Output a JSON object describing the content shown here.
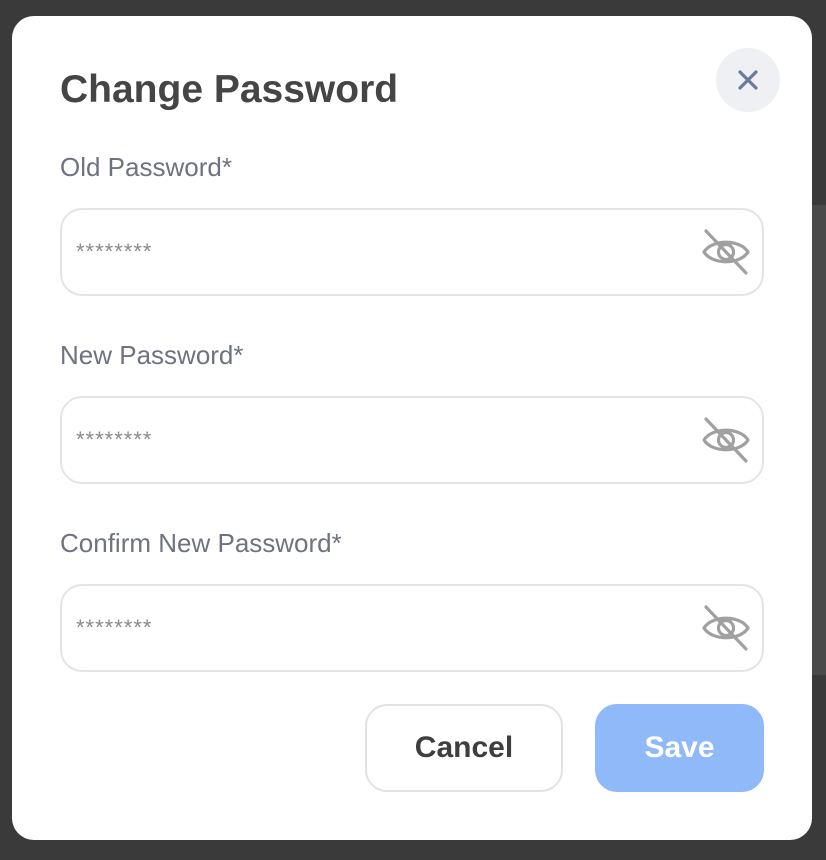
{
  "dialog": {
    "title": "Change Password",
    "close_icon": "close-icon"
  },
  "fields": [
    {
      "label": "Old Password*",
      "placeholder": "********",
      "value": "",
      "icon": "eye-off-icon"
    },
    {
      "label": "New Password*",
      "placeholder": "********",
      "value": "",
      "icon": "eye-off-icon"
    },
    {
      "label": "Confirm New Password*",
      "placeholder": "********",
      "value": "",
      "icon": "eye-off-icon"
    }
  ],
  "actions": {
    "cancel_label": "Cancel",
    "save_label": "Save"
  },
  "colors": {
    "save_button_bg": "#8fb9f8",
    "title_text": "#454545",
    "label_text": "#6f7280",
    "close_icon": "#6b7a99",
    "eye_icon": "#a0a0a0"
  }
}
